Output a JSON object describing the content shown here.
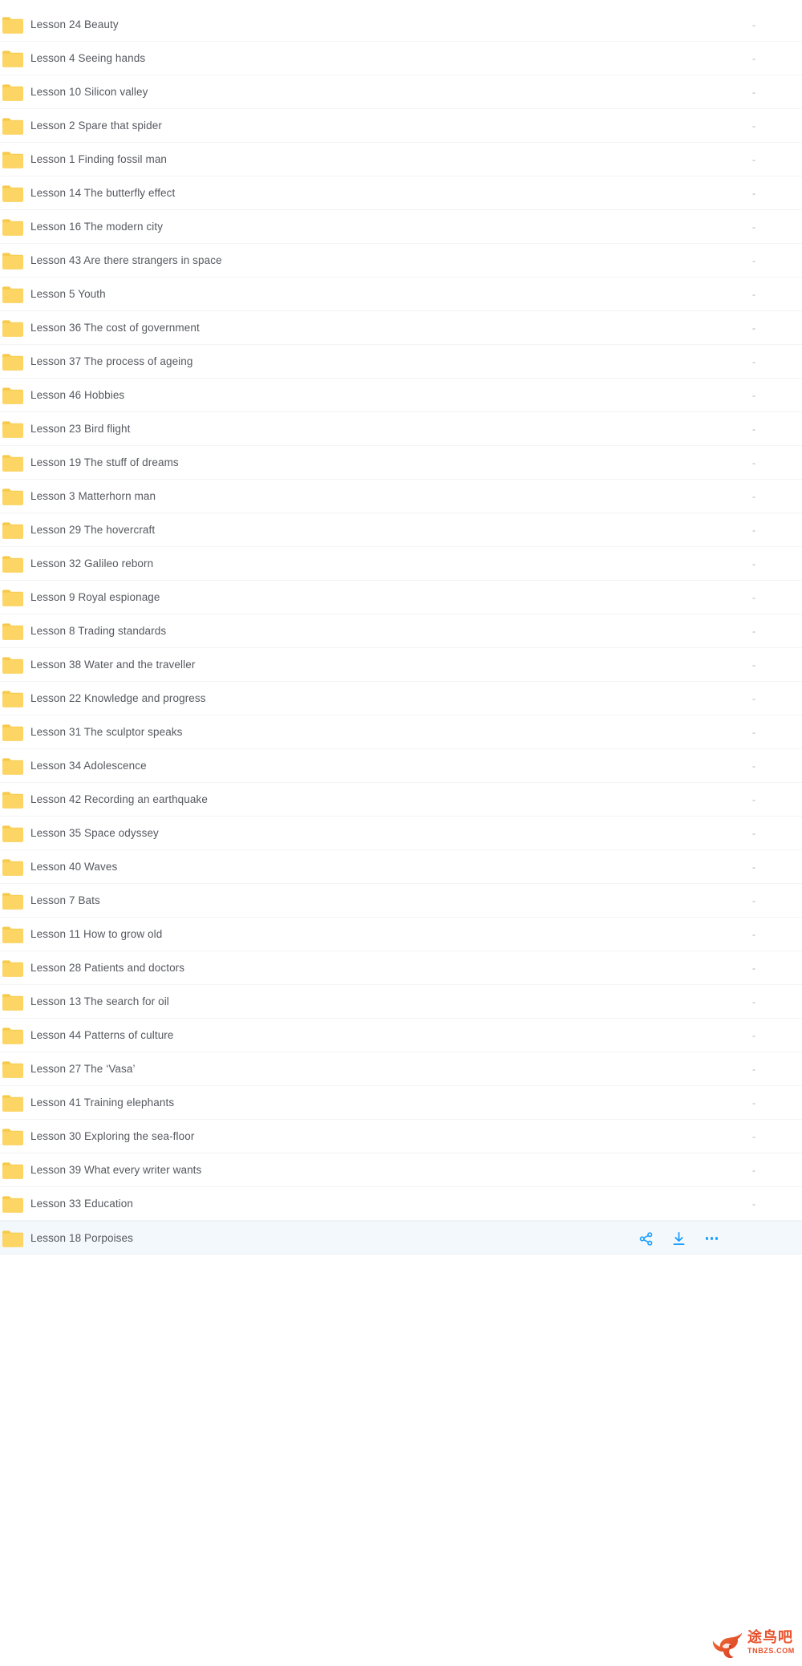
{
  "list": {
    "icon_name": "folder-icon",
    "folder_color": "#fcd565",
    "folder_color_dark": "#f7c948",
    "text_color": "#55585f",
    "selected_row_bg": "#f3f8fc",
    "accent_color": "#1e9fff",
    "empty_size_label": "-",
    "rows": [
      {
        "name": "Lesson 24 Beauty",
        "size": "-"
      },
      {
        "name": "Lesson 4 Seeing hands",
        "size": "-"
      },
      {
        "name": "Lesson 10 Silicon valley",
        "size": "-"
      },
      {
        "name": "Lesson 2 Spare that spider",
        "size": "-"
      },
      {
        "name": "Lesson 1 Finding fossil man",
        "size": "-"
      },
      {
        "name": "Lesson 14 The butterfly effect",
        "size": "-"
      },
      {
        "name": "Lesson 16 The modern city",
        "size": "-"
      },
      {
        "name": "Lesson 43 Are there strangers in space",
        "size": "-"
      },
      {
        "name": "Lesson 5 Youth",
        "size": "-"
      },
      {
        "name": "Lesson 36 The cost of government",
        "size": "-"
      },
      {
        "name": "Lesson 37 The process of ageing",
        "size": "-"
      },
      {
        "name": "Lesson 46 Hobbies",
        "size": "-"
      },
      {
        "name": "Lesson 23 Bird flight",
        "size": "-"
      },
      {
        "name": "Lesson 19 The stuff of dreams",
        "size": "-"
      },
      {
        "name": "Lesson 3 Matterhorn man",
        "size": "-"
      },
      {
        "name": "Lesson 29 The hovercraft",
        "size": "-"
      },
      {
        "name": "Lesson 32 Galileo reborn",
        "size": "-"
      },
      {
        "name": "Lesson 9 Royal espionage",
        "size": "-"
      },
      {
        "name": "Lesson 8 Trading standards",
        "size": "-"
      },
      {
        "name": "Lesson 38 Water and the traveller",
        "size": "-"
      },
      {
        "name": "Lesson 22 Knowledge and progress",
        "size": "-"
      },
      {
        "name": "Lesson 31 The sculptor speaks",
        "size": "-"
      },
      {
        "name": "Lesson 34 Adolescence",
        "size": "-"
      },
      {
        "name": "Lesson 42 Recording an earthquake",
        "size": "-"
      },
      {
        "name": "Lesson 35 Space odyssey",
        "size": "-"
      },
      {
        "name": "Lesson 40 Waves",
        "size": "-"
      },
      {
        "name": "Lesson 7 Bats",
        "size": "-"
      },
      {
        "name": "Lesson 11 How to grow old",
        "size": "-"
      },
      {
        "name": "Lesson 28 Patients and doctors",
        "size": "-"
      },
      {
        "name": "Lesson 13 The search for oil",
        "size": "-"
      },
      {
        "name": "Lesson 44 Patterns of culture",
        "size": "-"
      },
      {
        "name": "Lesson 27 The ‘Vasa’",
        "size": "-"
      },
      {
        "name": "Lesson 41 Training elephants",
        "size": "-"
      },
      {
        "name": "Lesson 30 Exploring the sea-floor",
        "size": "-"
      },
      {
        "name": "Lesson 39 What every writer wants",
        "size": "-"
      },
      {
        "name": "Lesson 33 Education",
        "size": "-"
      },
      {
        "name": "Lesson 18 Porpoises",
        "size": "",
        "selected": true
      }
    ]
  },
  "row_actions": {
    "share": {
      "icon_name": "share-icon",
      "label": "Share"
    },
    "download": {
      "icon_name": "download-icon",
      "label": "Download"
    },
    "more": {
      "icon_name": "more-dots-icon",
      "label": "More"
    }
  },
  "watermark": {
    "logo_name": "phoenix-bird-logo",
    "text_cn": "途鸟吧",
    "text_en": "TNBZS.COM",
    "color": "#e8502a"
  }
}
